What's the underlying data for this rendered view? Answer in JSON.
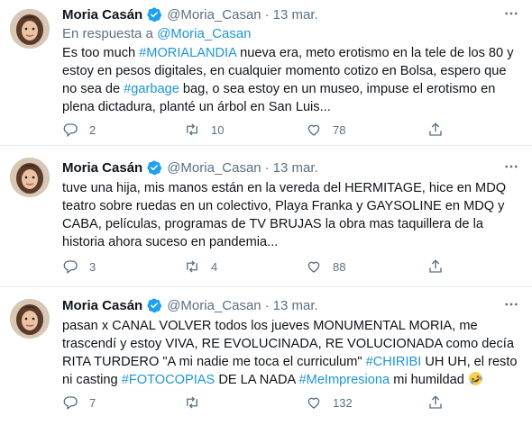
{
  "tweets": [
    {
      "name": "Moria Casán",
      "handle": "@Moria_Casan",
      "dot": "·",
      "date": "13 mar.",
      "reply_prefix": "En respuesta a",
      "reply_handle": "@Moria_Casan",
      "text": [
        {
          "t": "Es too much ",
          "link": false
        },
        {
          "t": "#MORIALANDIA",
          "link": true
        },
        {
          "t": " nueva era, meto erotismo en la tele de los 80 y estoy en pesos digitales, en cualquier momento cotizo en Bolsa, espero que no sea de ",
          "link": false
        },
        {
          "t": "#garbage",
          "link": true
        },
        {
          "t": " bag, o sea estoy en un museo, impuse el erotismo en plena dictadura, planté un árbol en San Luis...",
          "link": false
        }
      ],
      "replies": "2",
      "retweets": "10",
      "likes": "78"
    },
    {
      "name": "Moria Casán",
      "handle": "@Moria_Casan",
      "dot": "·",
      "date": "13 mar.",
      "text": [
        {
          "t": "tuve una hija, mis manos están en la vereda del HERMITAGE, hice en MDQ teatro sobre ruedas en un colectivo, Playa Franka y GAYSOLINE en MDQ y CABA, películas, programas de TV BRUJAS la obra mas taquillera de la historia ahora suceso en pandemia...",
          "link": false
        }
      ],
      "replies": "3",
      "retweets": "4",
      "likes": "88"
    },
    {
      "name": "Moria Casán",
      "handle": "@Moria_Casan",
      "dot": "·",
      "date": "13 mar.",
      "text": [
        {
          "t": "pasan x CANAL VOLVER todos los jueves MONUMENTAL MORIA, me trascendí y estoy VIVA, RE EVOLUCINADA, RE VOLUCIONADA como decía RITA TURDERO \"A mi nadie me toca el curriculum\" ",
          "link": false
        },
        {
          "t": "#CHIRIBI",
          "link": true
        },
        {
          "t": " UH UH, el resto ni casting ",
          "link": false
        },
        {
          "t": "#FOTOCOPIAS",
          "link": true
        },
        {
          "t": " DE LA NADA ",
          "link": false
        },
        {
          "t": "#MeImpresiona",
          "link": true
        },
        {
          "t": " mi humildad ",
          "link": false
        }
      ],
      "emoji": "rolling-on-floor-laughing-emoji",
      "replies": "7",
      "retweets": "",
      "likes": "132"
    }
  ],
  "icons": {
    "verified": "verified-badge-icon",
    "more": "more-options-icon",
    "reply": "reply-icon",
    "retweet": "retweet-icon",
    "like": "like-icon",
    "share": "share-icon"
  },
  "colors": {
    "link": "#1b95e0",
    "secondary": "#5b7083",
    "verified": "#1da1f2",
    "divider": "#e6ecf0"
  }
}
